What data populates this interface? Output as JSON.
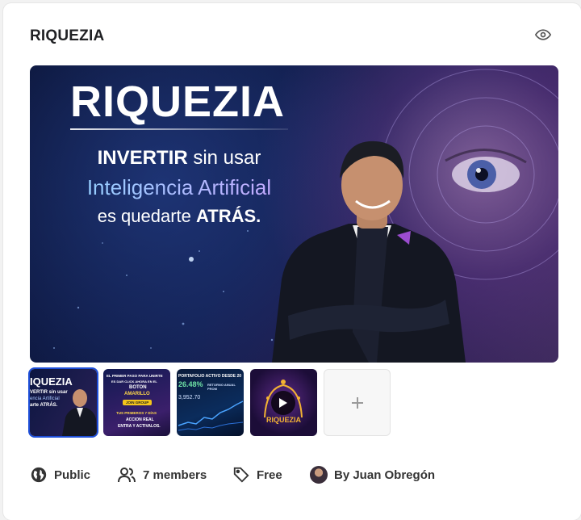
{
  "group": {
    "title": "RIQUEZIA"
  },
  "header": {
    "visibility_icon": "eye-icon"
  },
  "hero": {
    "brand": "RIQUEZIA",
    "line1_bold": "INVERTIR",
    "line1_rest": " sin usar",
    "line2": "Inteligencia Artificial",
    "line3_start": "es quedarte ",
    "line3_bold": "ATRÁS."
  },
  "thumbnails": {
    "t1": {
      "brand": "IQUEZIA",
      "l1": "VERTIR sin usar",
      "l2": "encia Artificial",
      "l3": "arte ATRÁS."
    },
    "t2": {
      "l1": "EL PRIMER PASO PARA UNIRTE",
      "l2": "ES DAR CLICK AHORA EN EL",
      "l3": "BOTON",
      "l4": "AMARILLO",
      "btn": "JOIN GROUP",
      "l5": "TUS PRIMEROS 7 DÍAS",
      "l6": "ACCION REAL",
      "l7": "ENTRA Y ACTIVALOS."
    },
    "t3": {
      "l1": "PORTAFOLIO ACTIVO DESDE 20",
      "pct": "26.48%",
      "l2": "RETORNO ANUAL PROM",
      "amount": "3,952.70"
    },
    "t4": {
      "brand": "RIQUEZIA",
      "play_icon": "play-icon"
    },
    "add_icon": "plus-icon"
  },
  "meta": {
    "privacy": {
      "icon": "globe-icon",
      "label": "Public"
    },
    "members": {
      "icon": "members-icon",
      "label": "7 members"
    },
    "price": {
      "icon": "tag-icon",
      "label": "Free"
    },
    "owner": {
      "label": "By Juan Obregón"
    }
  },
  "colors": {
    "selected_border": "#1d4ed8",
    "text": "#202124",
    "meta_text": "#333333"
  }
}
